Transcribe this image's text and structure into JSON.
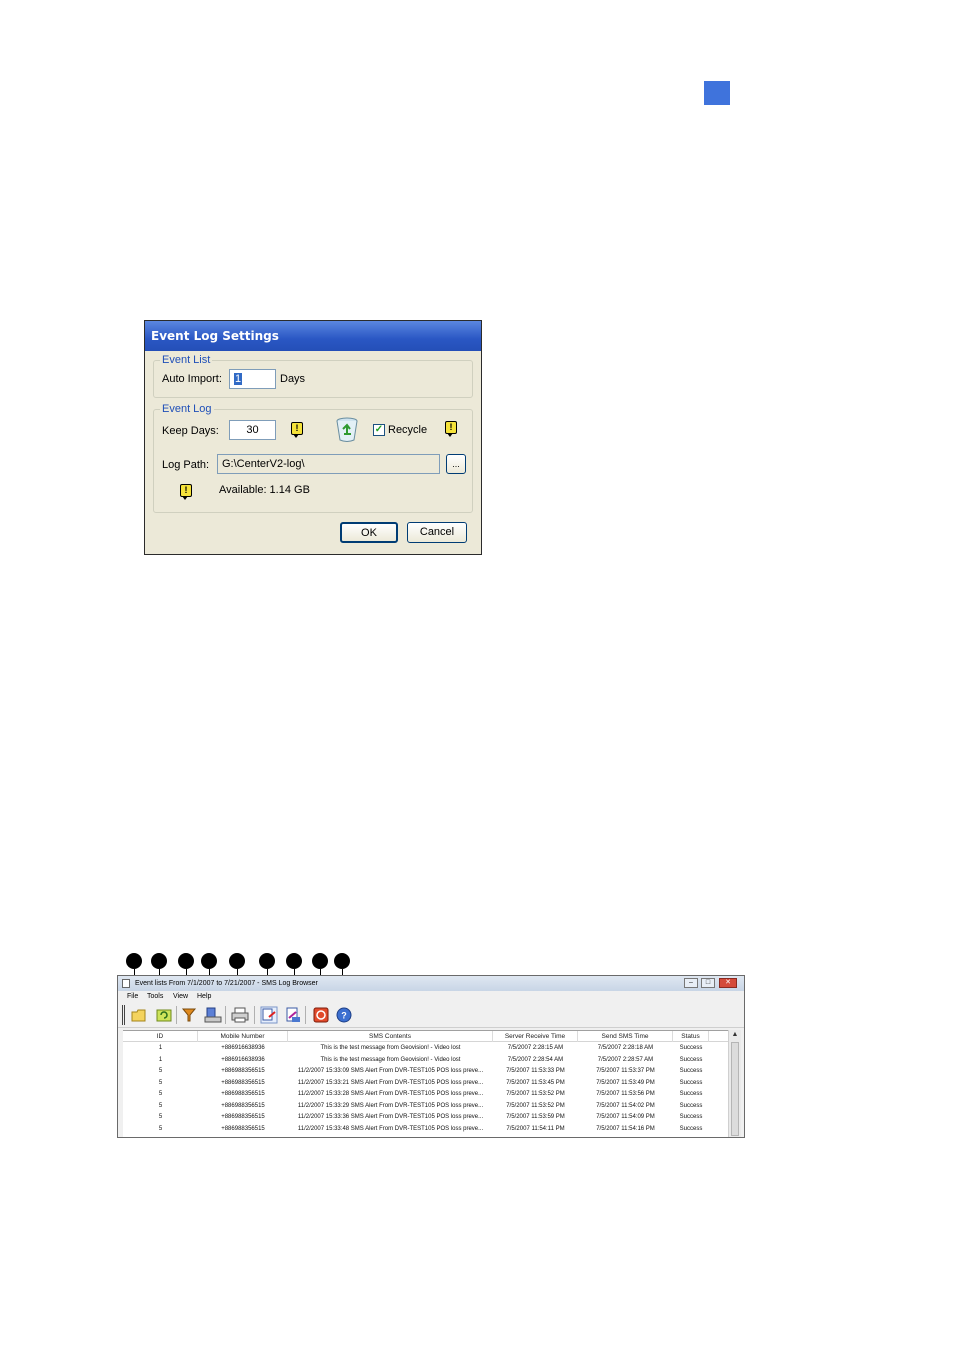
{
  "dialog": {
    "title": "Event Log Settings",
    "event_list": {
      "legend": "Event List",
      "auto_import_label": "Auto Import:",
      "auto_import_value": "1",
      "days_label": "Days"
    },
    "event_log": {
      "legend": "Event Log",
      "keep_days_label": "Keep Days:",
      "keep_days_value": "30",
      "recycle_label": "Recycle",
      "recycle_checked": "✓",
      "log_path_label": "Log Path:",
      "log_path_value": "G:\\CenterV2-log\\",
      "browse_label": "...",
      "available_text": "Available: 1.14 GB",
      "warn_mark": "!"
    },
    "ok_label": "OK",
    "cancel_label": "Cancel"
  },
  "browser": {
    "title": "Event lists From 7/1/2007 to 7/21/2007 - SMS Log Browser",
    "menu": [
      "File",
      "Tools",
      "View",
      "Help"
    ],
    "window_buttons": {
      "minimize": "–",
      "maximize": "□",
      "close": "✕"
    },
    "columns": [
      "ID",
      "Mobile Number",
      "SMS Contents",
      "Server Receive Time",
      "Send SMS Time",
      "Status"
    ],
    "rows": [
      [
        "1",
        "+886916638936",
        "This is the test message from Geovision! - Video lost",
        "7/5/2007 2:28:15 AM",
        "7/5/2007 2:28:18 AM",
        "Success"
      ],
      [
        "1",
        "+886916638936",
        "This is the test message from Geovision! - Video lost",
        "7/5/2007 2:28:54 AM",
        "7/5/2007 2:28:57 AM",
        "Success"
      ],
      [
        "5",
        "+886988356515",
        "11/2/2007 15:33:09 SMS Alert From DVR-TEST105 POS loss preve...",
        "7/5/2007 11:53:33 PM",
        "7/5/2007 11:53:37 PM",
        "Success"
      ],
      [
        "5",
        "+886988356515",
        "11/2/2007 15:33:21 SMS Alert From DVR-TEST105 POS loss preve...",
        "7/5/2007 11:53:45 PM",
        "7/5/2007 11:53:49 PM",
        "Success"
      ],
      [
        "5",
        "+886988356515",
        "11/2/2007 15:33:28 SMS Alert From DVR-TEST105 POS loss preve...",
        "7/5/2007 11:53:52 PM",
        "7/5/2007 11:53:56 PM",
        "Success"
      ],
      [
        "5",
        "+886988356515",
        "11/2/2007 15:33:29 SMS Alert From DVR-TEST105 POS loss preve...",
        "7/5/2007 11:53:52 PM",
        "7/5/2007 11:54:02 PM",
        "Success"
      ],
      [
        "5",
        "+886988356515",
        "11/2/2007 15:33:36 SMS Alert From DVR-TEST105 POS loss preve...",
        "7/5/2007 11:53:59 PM",
        "7/5/2007 11:54:09 PM",
        "Success"
      ],
      [
        "5",
        "+886988356515",
        "11/2/2007 15:33:48 SMS Alert From DVR-TEST105 POS loss preve...",
        "7/5/2007 11:54:11 PM",
        "7/5/2007 11:54:16 PM",
        "Success"
      ]
    ],
    "toolbar_icons": [
      "open-folder-icon",
      "refresh-icon",
      "filter-icon",
      "save-disk-icon",
      "print-icon",
      "export-icon",
      "import-icon",
      "exit-icon",
      "help-icon"
    ],
    "colors": {
      "accent": "#3f73dc",
      "dialog_title": "#2a57c4",
      "dialog_bg": "#ece9d8"
    }
  }
}
